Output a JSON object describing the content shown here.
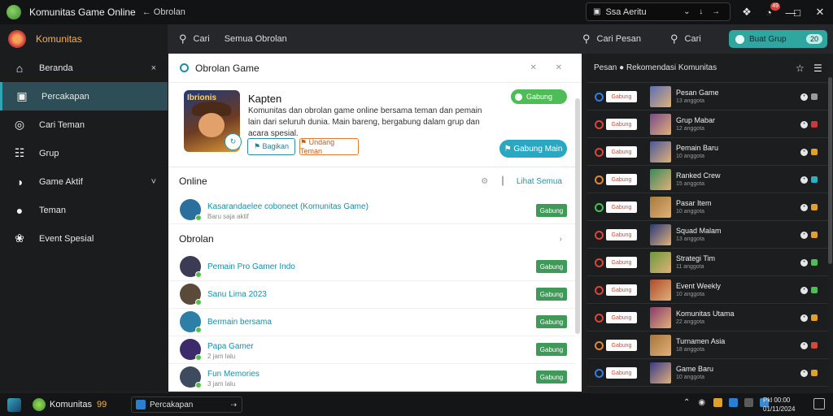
{
  "window": {
    "title": "Komunitas Game Online",
    "subtitle": "← Obrolan",
    "search": "Ssa Aeritu",
    "search_glyphs": "⌄ ↓ →",
    "notif_count": "49"
  },
  "sidebar": {
    "brand": "Komunitas",
    "items": [
      {
        "icon": "home-icon",
        "glyph": "⌂",
        "label": "Beranda",
        "tail": "×"
      },
      {
        "icon": "chat-icon",
        "glyph": "▣",
        "label": "Percakapan",
        "tail": ""
      },
      {
        "icon": "search-icon",
        "glyph": "◎",
        "label": "Cari Teman",
        "tail": ""
      },
      {
        "icon": "people-icon",
        "glyph": "☷",
        "label": "Grup",
        "tail": ""
      },
      {
        "icon": "gamepad-icon",
        "glyph": "◑",
        "label": "Game Aktif",
        "tail": "˅"
      },
      {
        "icon": "friends-icon",
        "glyph": "●",
        "label": "Teman",
        "tail": ""
      },
      {
        "icon": "trophy-icon",
        "glyph": "❀",
        "label": "Event Spesial",
        "tail": ""
      }
    ],
    "active_index": 1
  },
  "toolbar": {
    "search_label": "Cari",
    "filter_label": "Semua Obrolan",
    "right_search_1": "Cari Pesan",
    "right_search_2": "Cari",
    "pill_label": "Buat Grup",
    "pill_badge": "20"
  },
  "panel": {
    "header": "Obrolan Game",
    "header_controls": "✕ ✕",
    "feature": {
      "game_logo_text": "Ibrionis",
      "title": "Kapten",
      "description": "Komunitas dan obrolan game online bersama teman dan pemain lain dari seluruh dunia. Main bareng, bergabung dalam grup dan acara spesial.",
      "join_label": "Gabung",
      "btn1": "⚑ Bagikan",
      "btn2": "⚑ Undang Teman",
      "cta": "⚑ Gabung Main",
      "fab": "↻"
    },
    "online_title": "Online",
    "online_tools": "⚙ ┃",
    "online_link": "Lihat Semua",
    "online": [
      {
        "name": "Kasarandaelee coboneet (Komunitas Game)",
        "sub": "Baru saja aktif",
        "join": "Gabung",
        "color": "#2a6f9e"
      }
    ],
    "others_title": "Obrolan",
    "others_arrow": "›",
    "friends": [
      {
        "name": "Pemain Pro Gamer Indo",
        "sub": "",
        "join": "Gabung",
        "color": "#3b3b56"
      },
      {
        "name": "Sanu Lima 2023",
        "sub": "",
        "join": "Gabung",
        "color": "#5a4a3a"
      },
      {
        "name": "Bermain bersama",
        "sub": "",
        "join": "Gabung",
        "color": "#2e7fa8"
      },
      {
        "name": "Papa Gamer",
        "sub": "2 jam lalu",
        "join": "Gabung",
        "color": "#3d2a6a"
      },
      {
        "name": "Fun Memories",
        "sub": "3 jam lalu",
        "join": "Gabung",
        "color": "#3e4a5e"
      }
    ]
  },
  "right": {
    "header": "Pesan ● Rekomendasi Komunitas",
    "header_icons": "☆ ☰",
    "rows": [
      {
        "ring": "#3a7bd5",
        "pill": "Gabung",
        "thumb": "#5a6fb5",
        "name": "Pesan Game",
        "sub": "13 anggota",
        "badge": "#9a9a9a"
      },
      {
        "ring": "#d04a39",
        "pill": "Gabung",
        "thumb": "#7a4a8a",
        "name": "Grup Mabar",
        "sub": "12 anggota",
        "badge": "#c73a3a"
      },
      {
        "ring": "#d04a39",
        "pill": "Gabung",
        "thumb": "#4a5a9a",
        "name": "Pemain Baru",
        "sub": "10 anggota",
        "badge": "#e0a02a"
      },
      {
        "ring": "#d9883a",
        "pill": "Gabung",
        "thumb": "#3a8a5a",
        "name": "Ranked Crew",
        "sub": "15 anggota",
        "badge": "#2ab0c0"
      },
      {
        "ring": "#4ebd57",
        "pill": "Gabung",
        "thumb": "#a87a3a",
        "name": "Pasar Item",
        "sub": "10 anggota",
        "badge": "#e0a02a"
      },
      {
        "ring": "#d04a39",
        "pill": "Gabung",
        "thumb": "#2a3a7a",
        "name": "Squad Malam",
        "sub": "13 anggota",
        "badge": "#e0a02a"
      },
      {
        "ring": "#d04a39",
        "pill": "Gabung",
        "thumb": "#6a9a3a",
        "name": "Strategi Tim",
        "sub": "11 anggota",
        "badge": "#4ebd57"
      },
      {
        "ring": "#d04a39",
        "pill": "Gabung",
        "thumb": "#b04a2a",
        "name": "Event Weekly",
        "sub": "10 anggota",
        "badge": "#4ebd57"
      },
      {
        "ring": "#d04a39",
        "pill": "Gabung",
        "thumb": "#8a3a6a",
        "name": "Komunitas Utama",
        "sub": "22 anggota",
        "badge": "#e0a02a"
      },
      {
        "ring": "#d9883a",
        "pill": "Gabung",
        "thumb": "#a8763a",
        "name": "Turnamen Asia",
        "sub": "18 anggota",
        "badge": "#d04a39"
      },
      {
        "ring": "#3a7bd5",
        "pill": "Gabung",
        "thumb": "#3a3a8a",
        "name": "Game Baru",
        "sub": "10 anggota",
        "badge": "#e0a02a"
      }
    ]
  },
  "taskbar": {
    "app_label": "Komunitas",
    "app_count": "99",
    "window_label": "Percakapan",
    "clock_line1": "Pkl 00:00",
    "clock_line2": "01/11/2024"
  }
}
